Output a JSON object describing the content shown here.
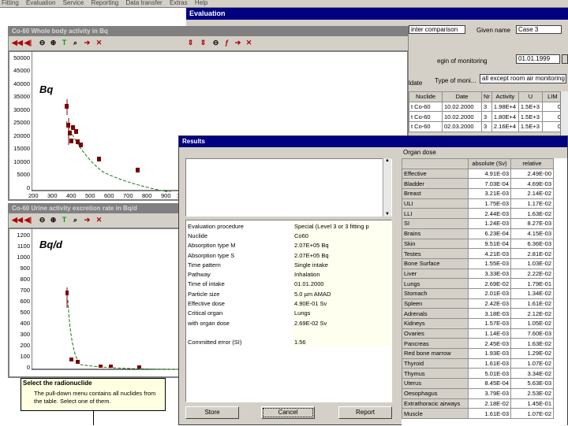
{
  "menu": [
    "Fitting",
    "Evaluation",
    "Service",
    "Reporting",
    "Data transfer",
    "Extras",
    "Help"
  ],
  "evaluation": {
    "title": "Evaluation",
    "top_field": "inter comparison",
    "given_name_label": "Given name",
    "given_name_value": "Case 3",
    "begin_label": "egin of monitoring",
    "begin_value": "01.01.1999",
    "type_label": "Type of moni...",
    "type_value": "all except room air monitoring",
    "table_headers": [
      "Nuclide",
      "Date",
      "Nr",
      "Activity",
      "U",
      "LIM"
    ],
    "table_rows": [
      [
        "t Co-60",
        "10.02.2000",
        "3",
        "1.98E+4",
        "1.5E+3",
        "0"
      ],
      [
        "t Co-60",
        "10.02.2000",
        "3",
        "1.80E+4",
        "1.5E+3",
        "0"
      ],
      [
        "t Co-60",
        "02.03.2000",
        "3",
        "2.16E+4",
        "1.5E+3",
        "0"
      ]
    ],
    "udate_label": "ldate"
  },
  "plot1": {
    "title": "Co-60 Whole body activity in Bq",
    "unit_label": "Bq",
    "yticks": [
      "50000",
      "45000",
      "40000",
      "35000",
      "30000",
      "25000",
      "20000",
      "15000",
      "10000",
      "5000",
      "0"
    ],
    "xticks": [
      "200",
      "300",
      "400",
      "500",
      "600",
      "700",
      "800",
      "900",
      "10"
    ]
  },
  "plot2": {
    "title": "Co-60 Urine activity excretion rate in Bq/d",
    "unit_label": "Bq/d",
    "yticks": [
      "1200",
      "1100",
      "1000",
      "900",
      "800",
      "700",
      "600",
      "500",
      "400",
      "300",
      "200",
      "100",
      "0"
    ]
  },
  "hint": {
    "title": "Select the radionuclide",
    "body": "The pull-down menu contains all nuclides from the table. Select one of them."
  },
  "results": {
    "title": "Results",
    "organ_dose_label": "Organ dose",
    "col_absolute": "absolute (Sv)",
    "col_relative": "relative",
    "properties": [
      [
        "Evaluation procedure",
        "Special (Level 3 or 3 fitting p"
      ],
      [
        "Nuclide",
        "Co60"
      ],
      [
        "Absorption type M",
        "2.07E+05 Bq"
      ],
      [
        "Absorption type S",
        "2.07E+05 Bq"
      ],
      [
        "Time pattern",
        "Single intake"
      ],
      [
        "Pathway",
        "Inhalation"
      ],
      [
        "Time of intake",
        "01.01.2000"
      ],
      [
        "Particle size",
        "5.0 µm AMAD"
      ],
      [
        "Effective dose",
        "4.90E-01 Sv"
      ],
      [
        "Critical organ",
        "Lungs"
      ],
      [
        "  with organ dose",
        "2.69E-02 Sv"
      ],
      [
        "",
        ""
      ],
      [
        "Committed error (SI)",
        "1.56"
      ]
    ],
    "organs": [
      [
        "Effective",
        "4.91E-03",
        "2.49E-00"
      ],
      [
        "Bladder",
        "7.03E-04",
        "4.69E-03"
      ],
      [
        "Breast",
        "3.21E-03",
        "2.14E-02"
      ],
      [
        "ULI",
        "1.75E-03",
        "1.17E-02"
      ],
      [
        "LLI",
        "2.44E-03",
        "1.63E-02"
      ],
      [
        "SI",
        "1.24E-03",
        "8.27E-03"
      ],
      [
        "Brains",
        "6.23E-04",
        "4.15E-03"
      ],
      [
        "Skin",
        "9.51E-04",
        "6.36E-03"
      ],
      [
        "Testes",
        "4.21E-03",
        "2.81E-02"
      ],
      [
        "Bone Surface",
        "1.55E-03",
        "1.03E-02"
      ],
      [
        "Liver",
        "3.33E-03",
        "2.22E-02"
      ],
      [
        "Lungs",
        "2.69E-02",
        "1.79E-01"
      ],
      [
        "Stomach",
        "2.01E-03",
        "1.34E-02"
      ],
      [
        "Spleen",
        "2.42E-03",
        "1.61E-02"
      ],
      [
        "Adrenals",
        "3.18E-03",
        "2.12E-02"
      ],
      [
        "Kidneys",
        "1.57E-03",
        "1.05E-02"
      ],
      [
        "Ovaries",
        "1.14E-03",
        "7.60E-03"
      ],
      [
        "Pancreas",
        "2.45E-03",
        "1.63E-02"
      ],
      [
        "Red bone marrow",
        "1.93E-03",
        "1.29E-02"
      ],
      [
        "Thyroid",
        "1.61E-03",
        "1.07E-02"
      ],
      [
        "Thymus",
        "5.01E-03",
        "3.34E-02"
      ],
      [
        "Uterus",
        "8.45E-04",
        "5.63E-03"
      ],
      [
        "Oesophagus",
        "3.79E-03",
        "2.53E-02"
      ],
      [
        "Extrathoracic airways",
        "2.18E-02",
        "1.45E-01"
      ],
      [
        "Muscle",
        "1.61E-03",
        "1.07E-02"
      ]
    ],
    "buttons": {
      "store": "Store",
      "cancel": "Cancel",
      "report": "Report"
    }
  }
}
